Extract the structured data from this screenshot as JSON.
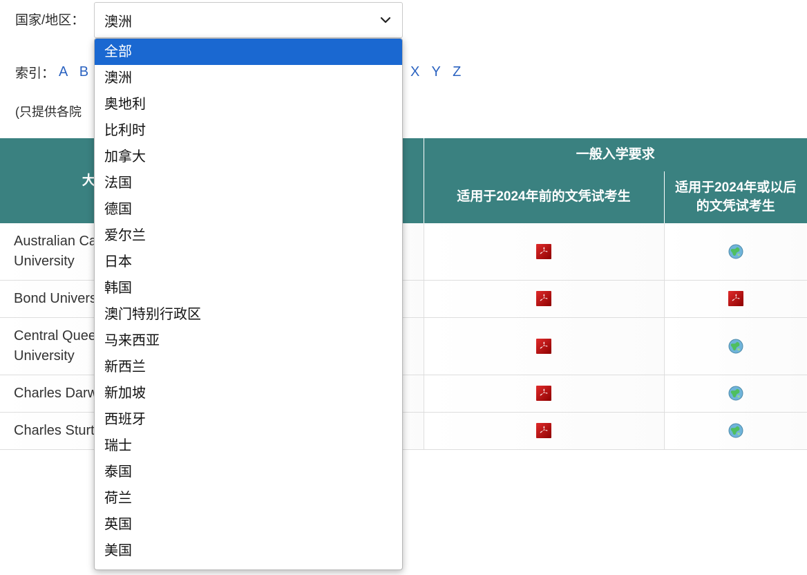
{
  "filter": {
    "label": "国家/地区：",
    "selected_value": "澳洲",
    "chevron_icon": "chevron-down-icon",
    "options": [
      "全部",
      "澳洲",
      "奥地利",
      "比利时",
      "加拿大",
      "法国",
      "德国",
      "爱尔兰",
      "日本",
      "韩国",
      "澳门特别行政区",
      "马来西亚",
      "新西兰",
      "新加坡",
      "西班牙",
      "瑞士",
      "泰国",
      "荷兰",
      "英国",
      "美国"
    ],
    "highlighted_option": "全部"
  },
  "index": {
    "label": "索引：",
    "letters_visible_left": [
      "A",
      "B"
    ],
    "letters_visible_right": [
      "X",
      "Y",
      "Z"
    ],
    "letters_left_text": "A B",
    "letters_right_text": "X Y Z"
  },
  "note": {
    "text": "(只提供各院"
  },
  "table": {
    "headers": {
      "university": "大学",
      "group_general_requirements": "一般入学要求",
      "pre2024": "适用于2024年前的文凭试考生",
      "pre2024_visible": "024年前的文凭试考生",
      "from2024": "适用于2024年或以后的文凭试考生"
    },
    "rows": [
      {
        "university": "Australian Catholic University",
        "university_visible": "Australian C … University",
        "pre2024_icon": "pdf-icon",
        "from2024_icon": "globe-icon"
      },
      {
        "university": "Bond University",
        "university_visible": "Bond Unive",
        "pre2024_icon": "pdf-icon",
        "from2024_icon": "pdf-icon"
      },
      {
        "university": "Central Queensland University",
        "university_visible": "Central Que … University",
        "pre2024_icon": "pdf-icon",
        "from2024_icon": "globe-icon"
      },
      {
        "university": "Charles Darwin University",
        "university_visible": "Charles Dar … University",
        "pre2024_icon": "pdf-icon",
        "from2024_icon": "globe-icon"
      },
      {
        "university": "Charles Sturt University",
        "university_visible": "Charles Stu … University",
        "pre2024_icon": "pdf-icon",
        "from2024_icon": "globe-icon"
      }
    ]
  },
  "colors": {
    "header_teal": "#3a8180",
    "highlight_blue": "#1a68d1",
    "link_blue": "#2a62c0",
    "pdf_red": "#c00000",
    "grid_gray": "#dddddd"
  }
}
